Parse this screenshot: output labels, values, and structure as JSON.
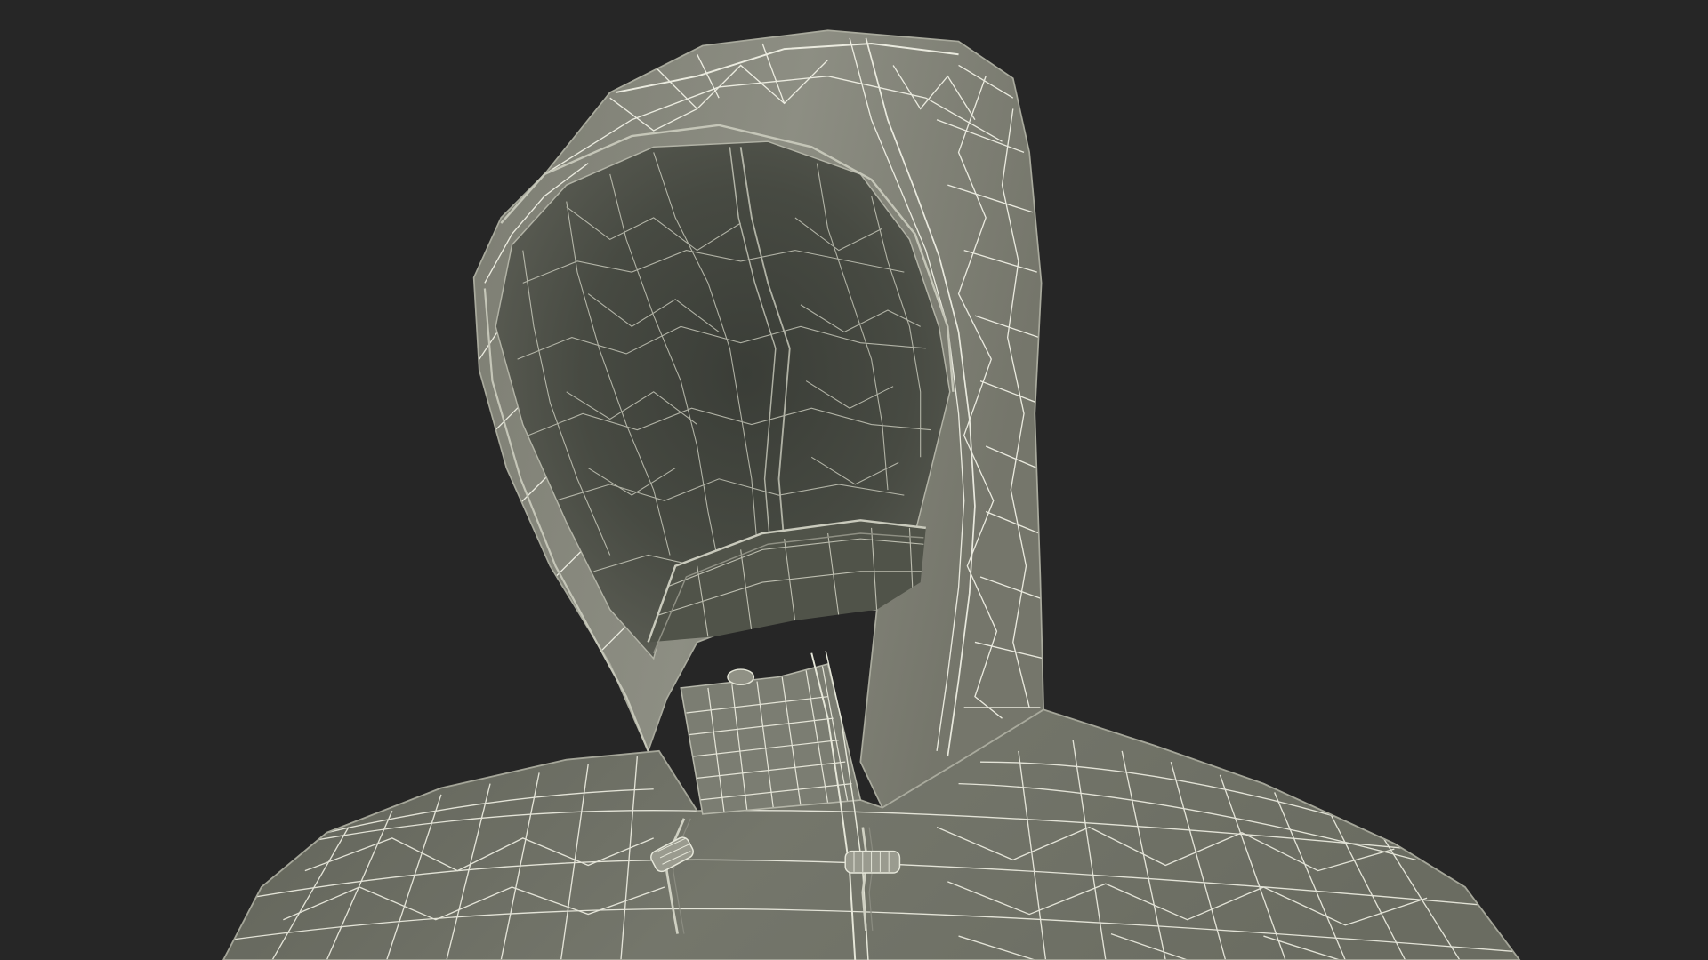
{
  "scene": {
    "subject": "hooded-jacket-wireframe",
    "colors": {
      "background": "#262626",
      "shell_light": "#8e8e84",
      "shell_mid": "#76776c",
      "shell_dark": "#5f6157",
      "interior": "#4a4d45",
      "interior_deep": "#3c3f39",
      "wire": "#f2f2e6",
      "wire_inner": "#d9dacb",
      "toggle_metal": "#b8b9ad"
    }
  }
}
